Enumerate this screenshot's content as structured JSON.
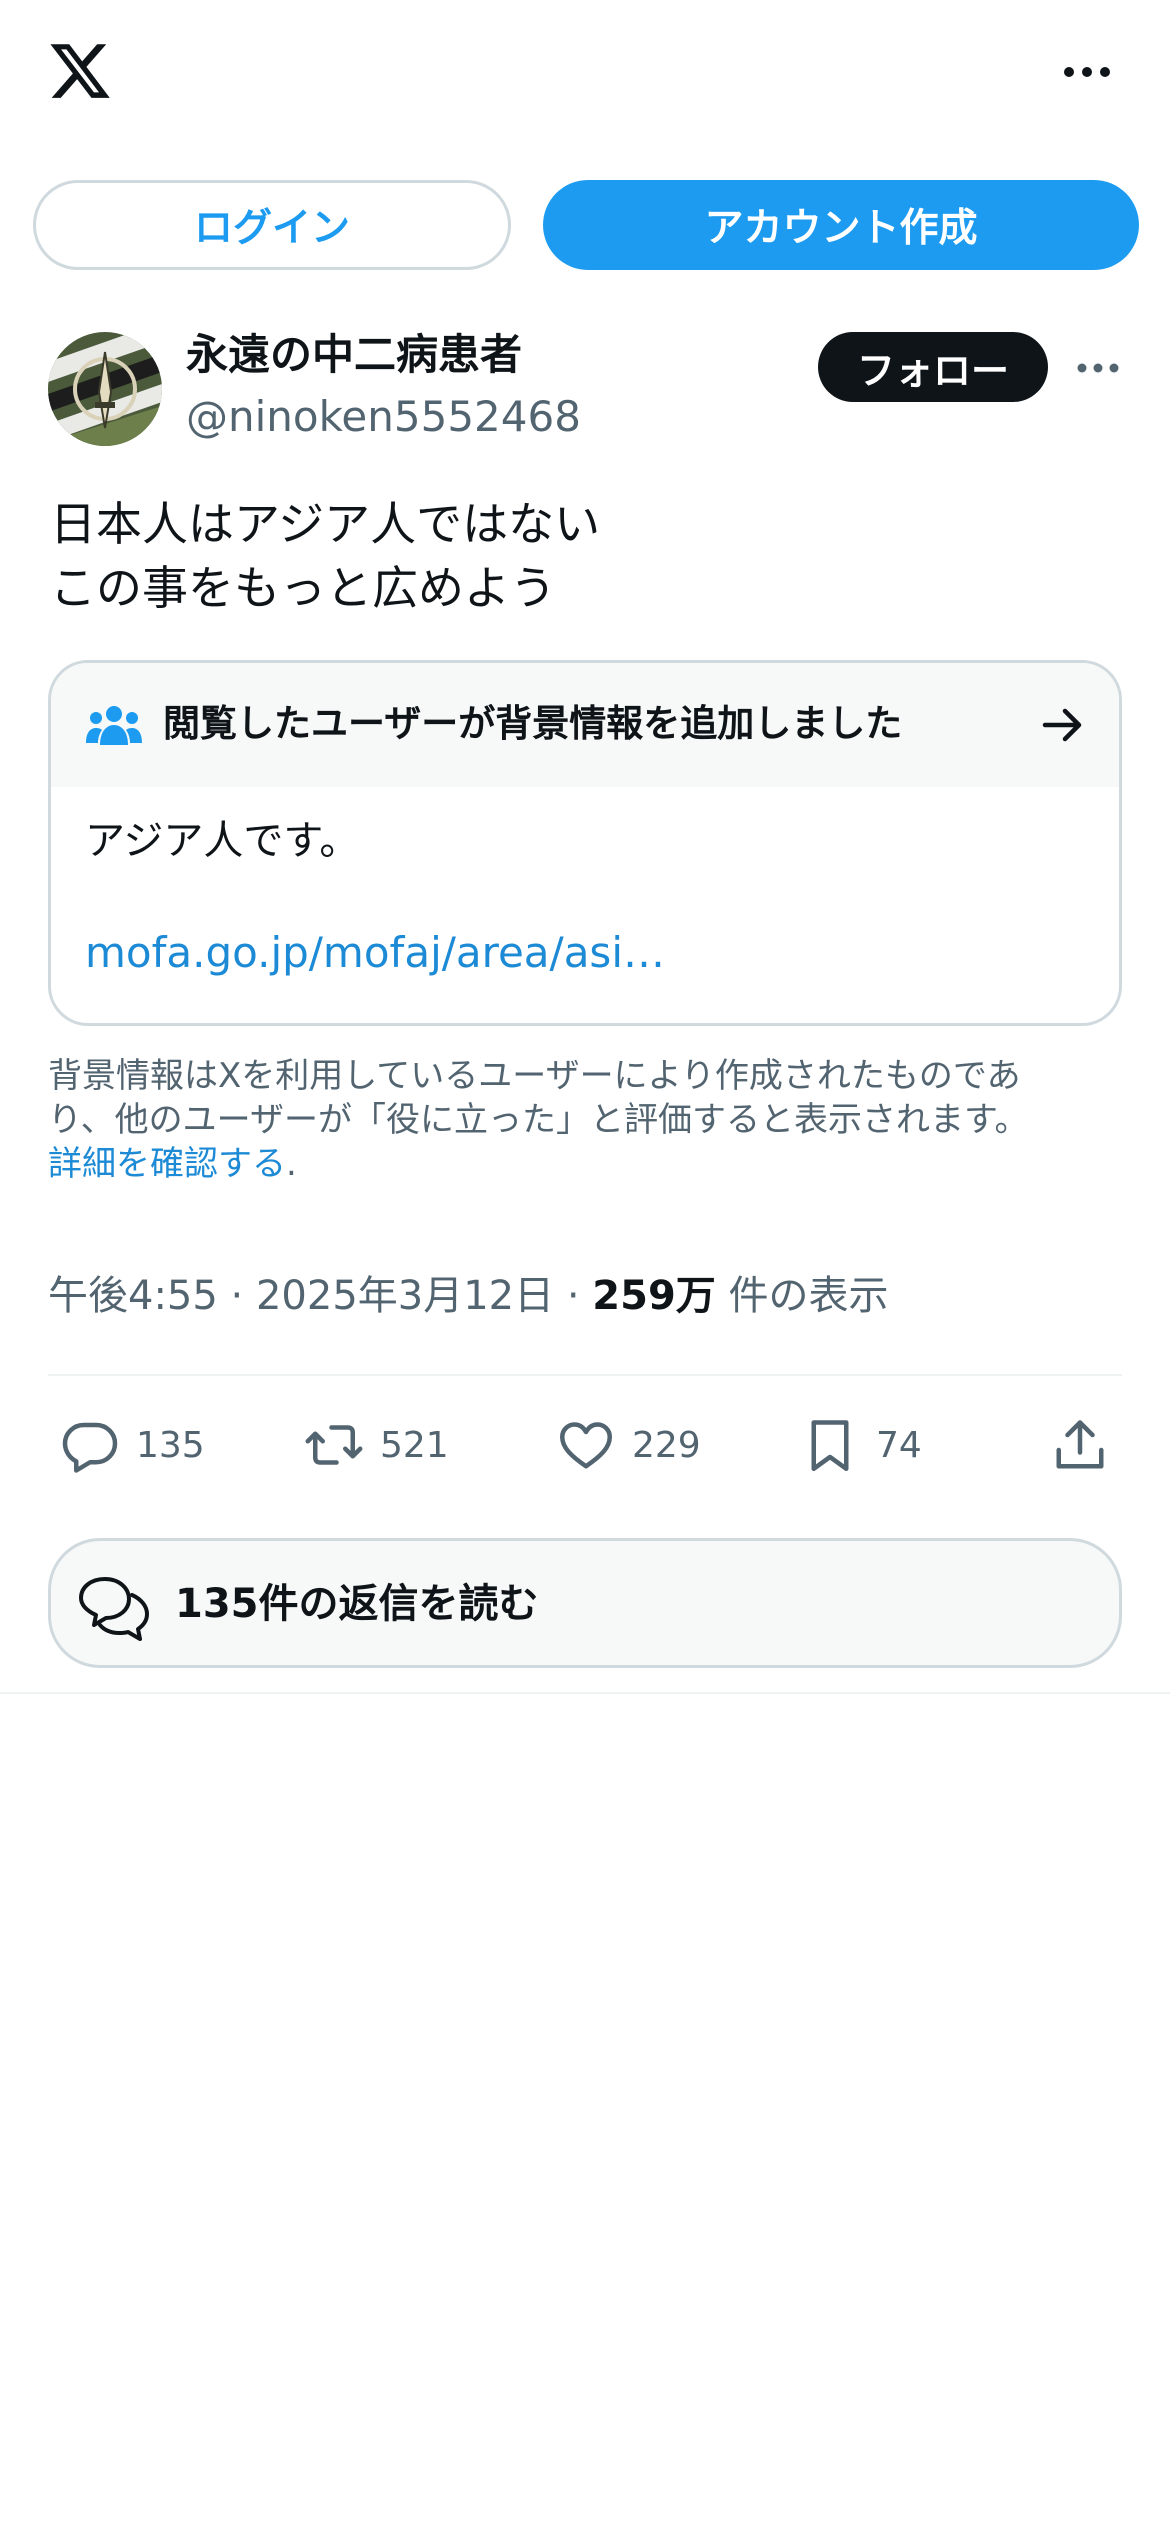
{
  "header": {
    "logo_icon": "x-logo-icon",
    "more_icon": "more-horizontal-icon"
  },
  "auth": {
    "login_label": "ログイン",
    "signup_label": "アカウント作成"
  },
  "tweet": {
    "display_name": "永遠の中二病患者",
    "handle": "@ninoken5552468",
    "follow_label": "フォロー",
    "text_lines": [
      "日本人はアジア人ではない",
      "この事をもっと広めよう"
    ],
    "meta": {
      "time": "午後4:55",
      "separator": "·",
      "date": "2025年3月12日",
      "views_count": "259万",
      "views_label": "件の表示"
    },
    "stats": {
      "replies": "135",
      "retweets": "521",
      "likes": "229",
      "bookmarks": "74"
    },
    "read_replies_label": "135件の返信を読む"
  },
  "community_note": {
    "header_label": "閲覧したユーザーが背景情報を追加しました",
    "body": "アジア人です。",
    "link": "mofa.go.jp/mofaj/area/asi…",
    "disclaimer_line1": "背景情報はXを利用しているユーザーにより作成されたものであ",
    "disclaimer_line2": "り、他のユーザーが「役に立った」と評価すると表示されます。",
    "learn_more": "詳細を確認する",
    "learn_more_suffix": "."
  },
  "colors": {
    "accent": "#1d9bf0",
    "link": "#1d8ad6",
    "text_primary": "#0f1419",
    "text_secondary": "#536471",
    "border": "#cfd9de",
    "card_bg": "#f7f9f9"
  }
}
